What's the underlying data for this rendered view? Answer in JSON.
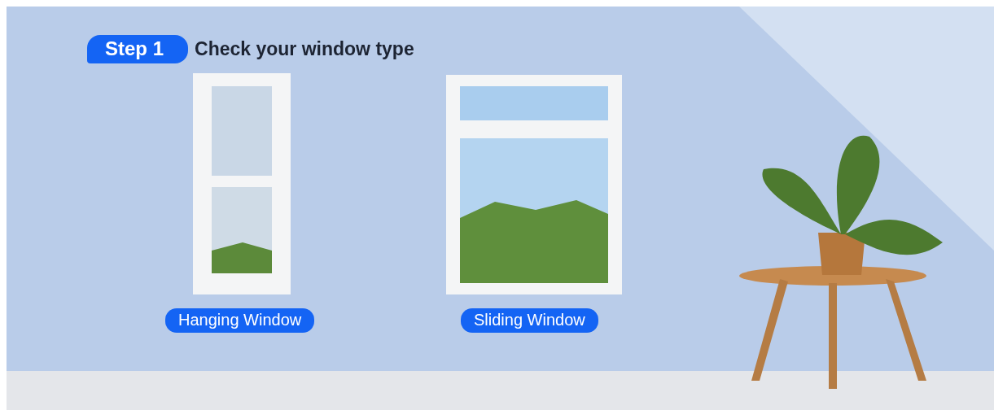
{
  "step": {
    "badge": "Step 1",
    "title": "Check your window type"
  },
  "options": [
    {
      "label": "Hanging Window"
    },
    {
      "label": "Sliding Window"
    }
  ]
}
